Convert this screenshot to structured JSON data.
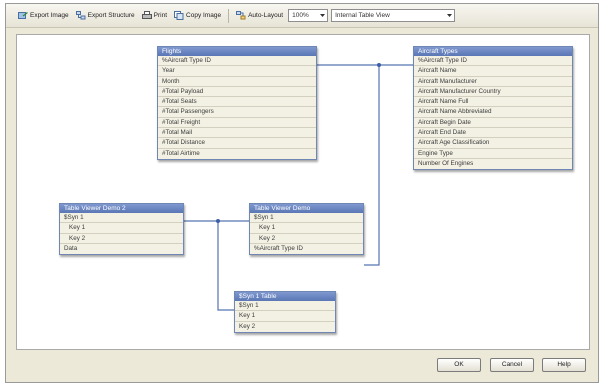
{
  "toolbar": {
    "export_image": "Export Image",
    "export_structure": "Export Structure",
    "print": "Print",
    "copy_image": "Copy Image",
    "auto_layout": "Auto-Layout",
    "zoom": "100%",
    "view": "Internal Table View"
  },
  "tables": {
    "flights": {
      "title": "Flights",
      "fields": [
        "%Aircraft Type ID",
        "Year",
        "Month",
        "#Total Payload",
        "#Total Seats",
        "#Total Passengers",
        "#Total Freight",
        "#Total Mail",
        "#Total Distance",
        "#Total Airtime"
      ]
    },
    "aircraft_types": {
      "title": "Aircraft Types",
      "fields": [
        "%Aircraft Type ID",
        "Aircraft Name",
        "Aircraft Manufacturer",
        "Aircraft Manufacturer Country",
        "Aircraft Name Full",
        "Aircraft Name Abbreviated",
        "Aircraft Begin Date",
        "Aircraft End Date",
        "Aircraft Age Classification",
        "Engine Type",
        "Number Of Engines"
      ]
    },
    "table_viewer_demo_2": {
      "title": "Table Viewer Demo 2",
      "fields": [
        "$Syn 1",
        "Key 1",
        "Key 2",
        "Data"
      ]
    },
    "table_viewer_demo": {
      "title": "Table Viewer Demo",
      "fields": [
        "$Syn 1",
        "Key 1",
        "Key 2",
        "%Aircraft Type ID"
      ]
    },
    "syn1_table": {
      "title": "$Syn 1 Table",
      "fields": [
        "$Syn 1",
        "Key 1",
        "Key 2"
      ]
    }
  },
  "footer": {
    "ok": "OK",
    "cancel": "Cancel",
    "help": "Help"
  }
}
